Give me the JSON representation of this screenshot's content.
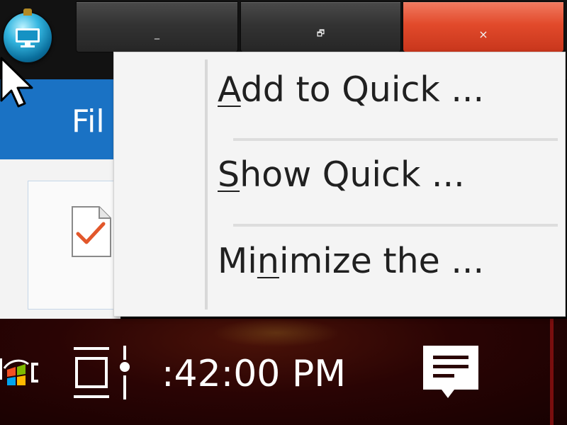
{
  "window": {
    "buttons": {
      "minimize_glyph": "_",
      "maximize_glyph": "🗗",
      "close_glyph": "×"
    },
    "app_icon": "globe-computer-icon"
  },
  "ribbon": {
    "file_tab_label": "File",
    "file_tab_visible_text": "Fil"
  },
  "context_menu": {
    "items": [
      {
        "pre": "",
        "mnemonic": "A",
        "post": "dd to Quick ...",
        "full": "Add to Quick ..."
      },
      {
        "pre": "",
        "mnemonic": "S",
        "post": "how Quick ...",
        "full": "Show Quick ..."
      },
      {
        "pre": "Mi",
        "mnemonic": "n",
        "post": "imize the ...",
        "full": "Minimize the ..."
      }
    ]
  },
  "taskbar": {
    "clock_visible_text": ":42:00 PM",
    "icons": [
      "windows-start-icon",
      "task-view-icon",
      "notification-icon"
    ]
  },
  "colors": {
    "ribbon_blue": "#1a72c4",
    "close_red": "#e24a2b",
    "taskbar_dark_red": "#2a0404",
    "menu_bg": "#f4f4f4"
  }
}
